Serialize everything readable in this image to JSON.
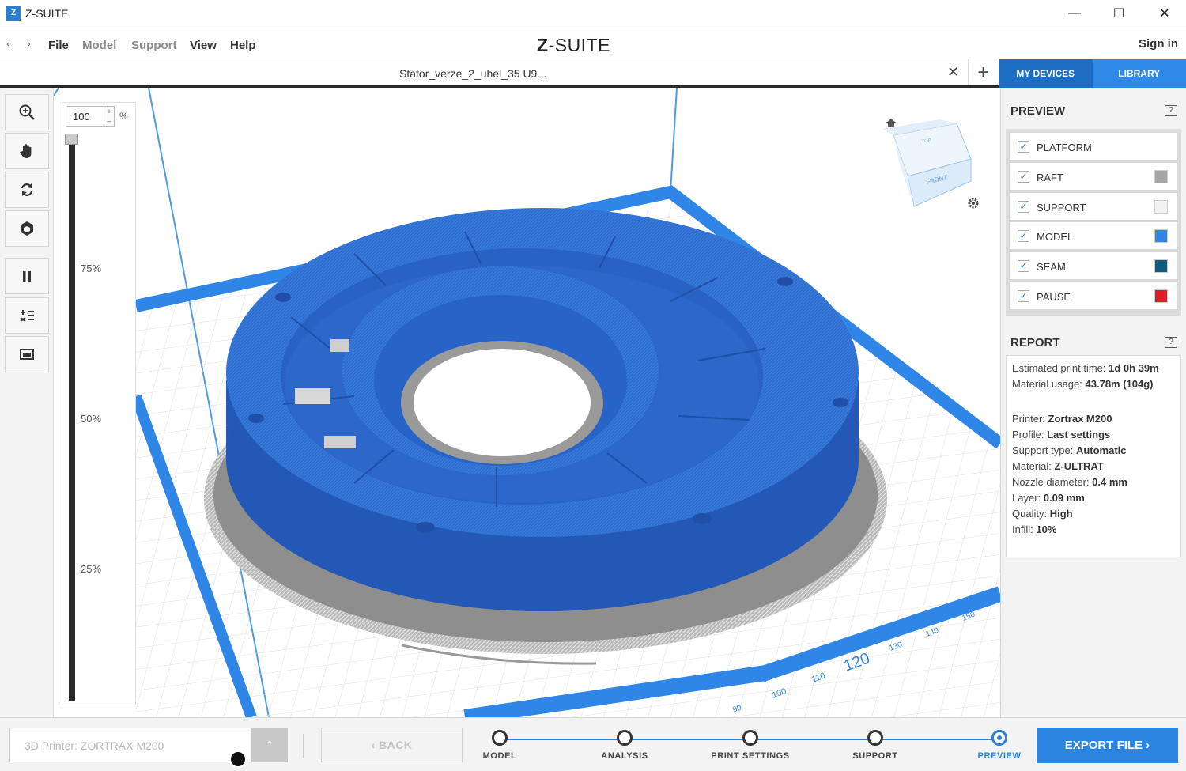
{
  "titlebar": {
    "logo": "Z",
    "title": "Z-SUITE",
    "minimize": "—",
    "maximize": "☐",
    "close": "✕"
  },
  "menu": {
    "back_arrow": "‹",
    "forward_arrow": "›",
    "items": [
      "File",
      "Model",
      "Support",
      "View",
      "Help"
    ],
    "brand_prefix": "Z",
    "brand_suffix": "-SUITE",
    "sign_in": "Sign in"
  },
  "tabs": {
    "file_name": "Stator_verze_2_uhel_35 U9...",
    "close": "✕",
    "add": "+",
    "my_devices": "MY DEVICES",
    "library": "LIBRARY"
  },
  "zoom": {
    "value": "100",
    "unit": "%",
    "spin": "+\n–",
    "level": 1.0,
    "marks": [
      "75%",
      "50%",
      "25%"
    ]
  },
  "viewport": {
    "ruler_labels": [
      "90",
      "100",
      "110",
      "120",
      "130",
      "140",
      "150"
    ],
    "cube_top": "TOP",
    "cube_front": "FRONT"
  },
  "preview": {
    "title": "PREVIEW",
    "help": "?",
    "check": "✓",
    "items": [
      {
        "label": "PLATFORM",
        "color": null
      },
      {
        "label": "RAFT",
        "color": "#a6a6a6"
      },
      {
        "label": "SUPPORT",
        "color": "#f2f2f2"
      },
      {
        "label": "MODEL",
        "color": "#2f86e6"
      },
      {
        "label": "SEAM",
        "color": "#0e5b80"
      },
      {
        "label": "PAUSE",
        "color": "#de1e26"
      }
    ]
  },
  "report": {
    "title": "REPORT",
    "help": "?",
    "estimated_print_time_label": "Estimated print time:",
    "estimated_print_time": "1d 0h 39m",
    "material_usage_label": "Material usage:",
    "material_usage": "43.78m (104g)",
    "printer_label": "Printer:",
    "printer": "Zortrax M200",
    "profile_label": "Profile:",
    "profile": "Last settings",
    "support_type_label": "Support type:",
    "support_type": "Automatic",
    "material_label": "Material:",
    "material": "Z-ULTRAT",
    "nozzle_label": "Nozzle diameter:",
    "nozzle": "0.4 mm",
    "layer_label": "Layer:",
    "layer": "0.09 mm",
    "quality_label": "Quality:",
    "quality": "High",
    "infill_label": "Infill:",
    "infill": "10%"
  },
  "bottom": {
    "printer_select": "3D Printer: ZORTRAX M200",
    "printer_arrow": "⌃",
    "back": "‹  BACK",
    "steps": [
      "MODEL",
      "ANALYSIS",
      "PRINT SETTINGS",
      "SUPPORT",
      "PREVIEW"
    ],
    "active_step": "PREVIEW",
    "export": "EXPORT FILE ›"
  },
  "colors": {
    "accent": "#2a7fd4",
    "model": "#2f6fd0",
    "platform_blue": "#2f86e6"
  }
}
